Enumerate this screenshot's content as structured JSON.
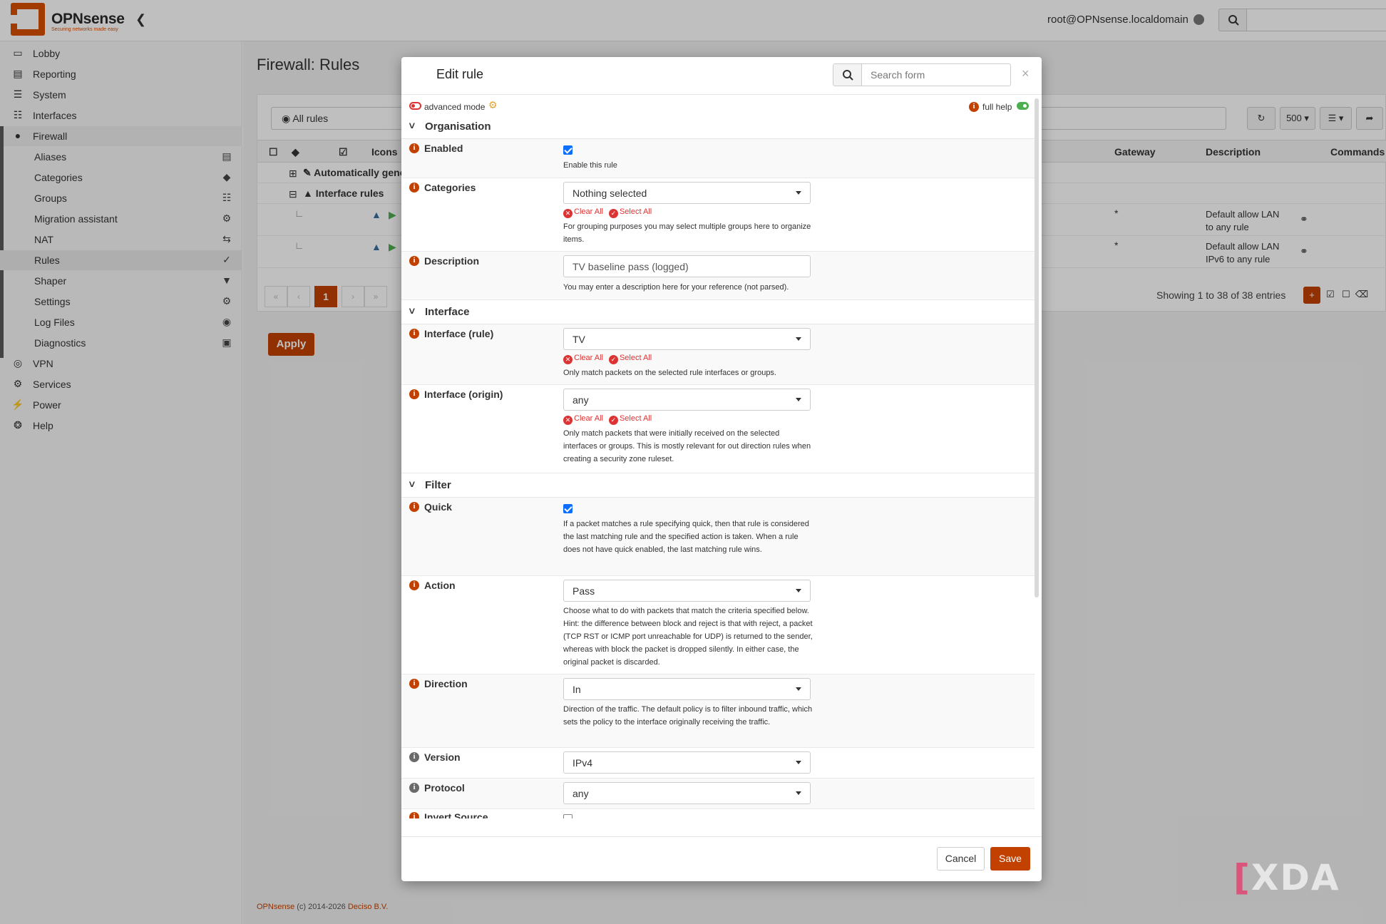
{
  "header": {
    "brand": "OPNsense",
    "tagline": "Securing networks made easy",
    "collapse_icon": "chevron-left-icon",
    "user": "root@OPNsense.localdomain",
    "search_icon": "search-icon"
  },
  "sidebar": {
    "items": [
      {
        "label": "Lobby",
        "icon": "laptop-icon"
      },
      {
        "label": "Reporting",
        "icon": "chart-icon"
      },
      {
        "label": "System",
        "icon": "server-icon"
      },
      {
        "label": "Interfaces",
        "icon": "network-icon"
      },
      {
        "label": "Firewall",
        "icon": "fire-icon"
      },
      {
        "label": "VPN",
        "icon": "globe-icon"
      },
      {
        "label": "Services",
        "icon": "gear-icon"
      },
      {
        "label": "Power",
        "icon": "plug-icon"
      },
      {
        "label": "Help",
        "icon": "lifebuoy-icon"
      }
    ],
    "firewall_sub": [
      {
        "label": "Aliases",
        "icon": "list-icon"
      },
      {
        "label": "Categories",
        "icon": "tags-icon"
      },
      {
        "label": "Groups",
        "icon": "sitemap-icon"
      },
      {
        "label": "Migration assistant",
        "icon": "cogs-icon"
      },
      {
        "label": "NAT",
        "icon": "exchange-icon"
      },
      {
        "label": "Rules",
        "icon": "check-icon"
      },
      {
        "label": "Shaper",
        "icon": "filter-icon"
      },
      {
        "label": "Settings",
        "icon": "cogs-icon"
      },
      {
        "label": "Log Files",
        "icon": "eye-icon"
      },
      {
        "label": "Diagnostics",
        "icon": "medkit-icon"
      }
    ]
  },
  "page": {
    "title": "Firewall: Rules",
    "filter_label": "All rules",
    "rows_per_page": "500",
    "columns": {
      "icons": "Icons",
      "gateway": "Gateway",
      "description": "Description",
      "commands": "Commands"
    },
    "groups": [
      "Automatically gene",
      "Interface rules"
    ],
    "rows": [
      {
        "gateway": "*",
        "description_1": "Default allow LAN",
        "description_2": "to any rule"
      },
      {
        "gateway": "*",
        "description_1": "Default allow LAN",
        "description_2": "IPv6 to any rule"
      }
    ],
    "pager": {
      "first": "«",
      "prev": "‹",
      "current": "1",
      "next": "›",
      "last": "»"
    },
    "showing": "Showing 1 to 38 of 38 entries",
    "apply": "Apply",
    "footer_brand": "OPNsense",
    "footer_text": " (c) 2014-2026 ",
    "footer_company": "Deciso B.V."
  },
  "modal": {
    "title": "Edit rule",
    "search_placeholder": "Search form",
    "close": "×",
    "advanced_mode": "advanced mode",
    "full_help": "full help",
    "cancel": "Cancel",
    "save": "Save",
    "clear_all": "Clear All",
    "select_all": "Select All",
    "sections": {
      "organisation": "Organisation",
      "interface": "Interface",
      "filter": "Filter"
    },
    "fields": {
      "enabled": {
        "label": "Enabled",
        "checked": true,
        "help": "Enable this rule"
      },
      "categories": {
        "label": "Categories",
        "value": "Nothing selected",
        "help": "For grouping purposes you may select multiple groups here to organize items."
      },
      "description": {
        "label": "Description",
        "value": "TV baseline pass (logged)",
        "help": "You may enter a description here for your reference (not parsed)."
      },
      "interface_rule": {
        "label": "Interface (rule)",
        "value": "TV",
        "help": "Only match packets on the selected rule interfaces or groups."
      },
      "interface_origin": {
        "label": "Interface (origin)",
        "value": "any",
        "help": "Only match packets that were initially received on the selected interfaces or groups. This is mostly relevant for out direction rules when creating a security zone ruleset."
      },
      "quick": {
        "label": "Quick",
        "checked": true,
        "help": "If a packet matches a rule specifying quick, then that rule is considered the last matching rule and the specified action is taken. When a rule does not have quick enabled, the last matching rule wins."
      },
      "action": {
        "label": "Action",
        "value": "Pass",
        "help": "Choose what to do with packets that match the criteria specified below. Hint: the difference between block and reject is that with reject, a packet (TCP RST or ICMP port unreachable for UDP) is returned to the sender, whereas with block the packet is dropped silently. In either case, the original packet is discarded."
      },
      "direction": {
        "label": "Direction",
        "value": "In",
        "help": "Direction of the traffic. The default policy is to filter inbound traffic, which sets the policy to the interface originally receiving the traffic."
      },
      "version": {
        "label": "Version",
        "value": "IPv4"
      },
      "protocol": {
        "label": "Protocol",
        "value": "any"
      },
      "invert_source": {
        "label": "Invert Source",
        "checked": false
      }
    }
  },
  "watermark": "XDA",
  "colors": {
    "accent": "#c24000",
    "brand": "#d94f00",
    "toggle_on": "#4caf50",
    "checkbox": "#0d6efd"
  }
}
